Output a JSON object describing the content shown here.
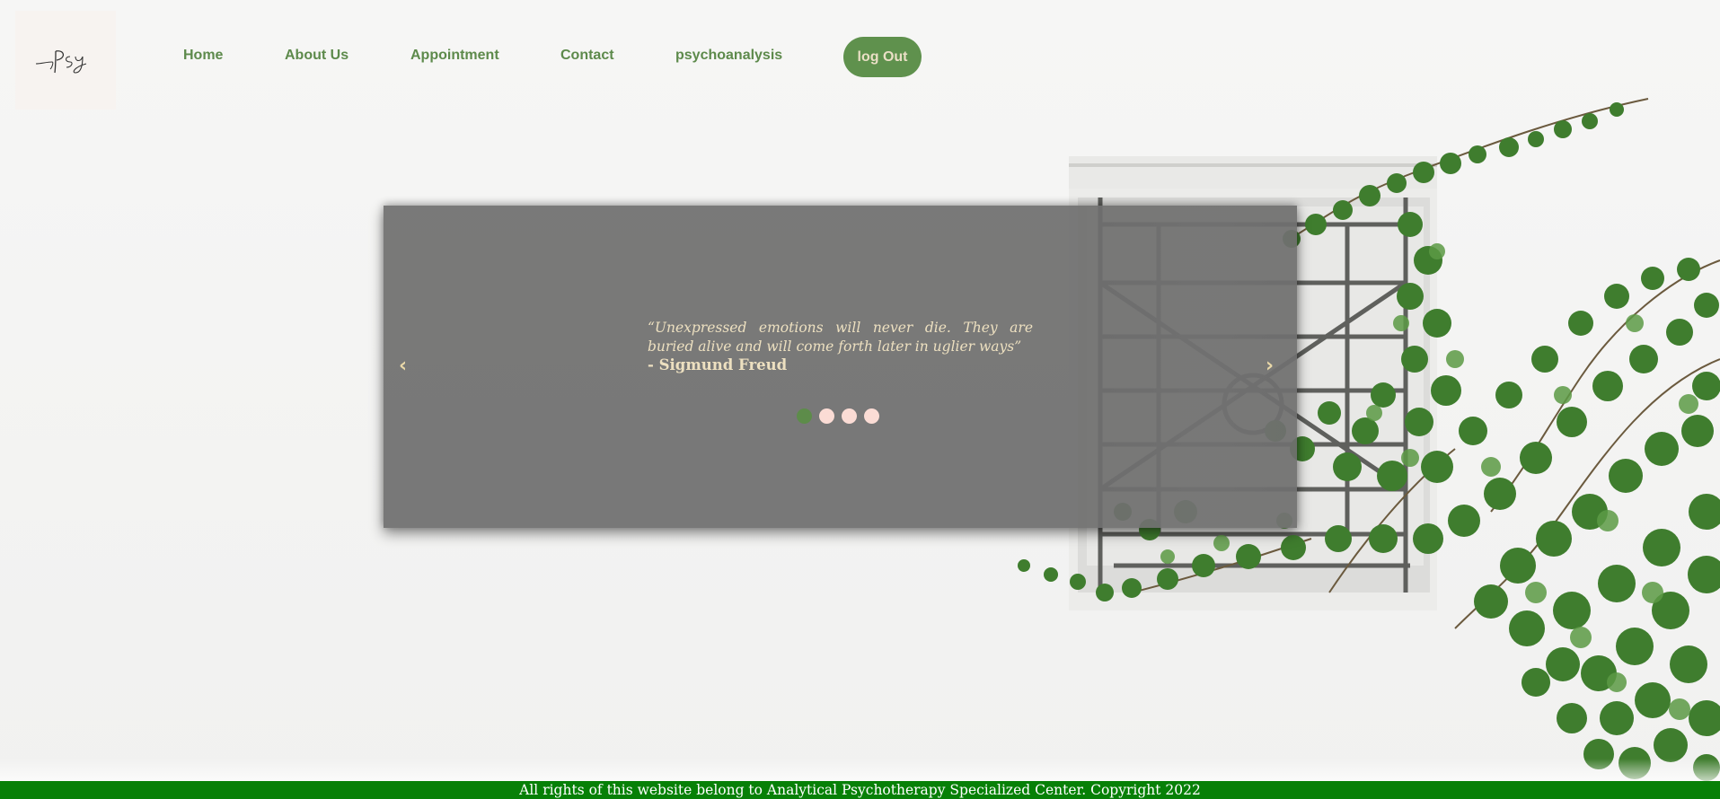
{
  "logo": {
    "text": "Psy"
  },
  "nav": {
    "items": [
      {
        "label": "Home"
      },
      {
        "label": "About Us"
      },
      {
        "label": "Appointment"
      },
      {
        "label": "Contact"
      },
      {
        "label": "psychoanalysis"
      }
    ],
    "logout_label": "log Out"
  },
  "slider": {
    "prev_icon": "‹",
    "next_icon": "›",
    "quote": "“Unexpressed emotions will never die. They are buried alive and will come forth later in uglier ways”",
    "author": "- Sigmund Freud",
    "slide_count": 4,
    "active_slide": 1
  },
  "footer": {
    "text": "All rights of this website belong to Analytical Psychotherapy Specialized Center. Copyright 2022"
  },
  "colors": {
    "accent": "#5f914d",
    "footer": "#078007",
    "quote_text": "#ede0c0",
    "dot": "#fbdcd5"
  },
  "icons": {
    "prev": "chevron-left-icon",
    "next": "chevron-right-icon",
    "logo": "signature-logo-icon"
  }
}
